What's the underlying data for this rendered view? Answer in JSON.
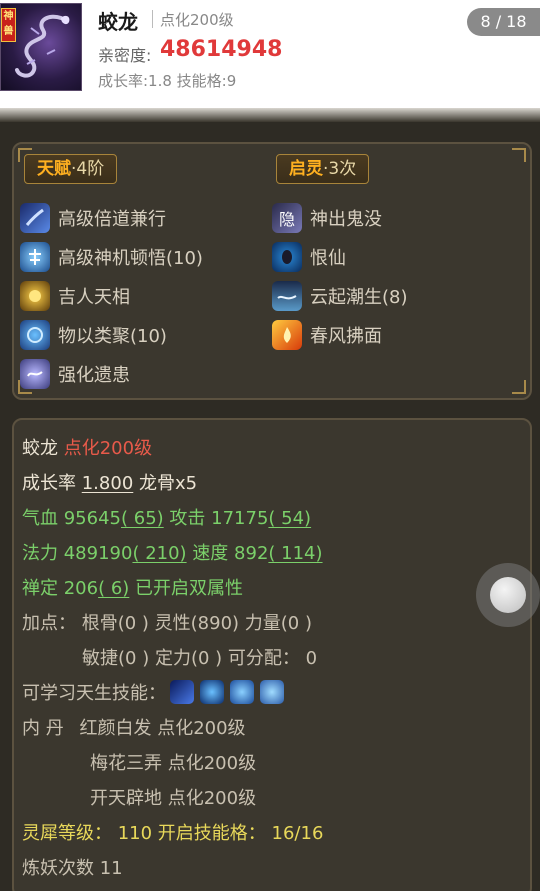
{
  "header": {
    "god_tag": "神兽",
    "pet_name": "蛟龙",
    "pet_level": "点化200级",
    "intimacy_label": "亲密度:",
    "intimacy_value": "48614948",
    "growth_line": "成长率:1.8  技能格:9",
    "page_indicator": "8 / 18"
  },
  "skills": {
    "talent_tag": {
      "name": "天赋",
      "suffix": "·4阶"
    },
    "awaken_tag": {
      "name": "启灵",
      "suffix": "·3次"
    },
    "left": [
      {
        "label": "高级倍道兼行",
        "icon": "wind-blade-icon",
        "color": "#3a6ad8"
      },
      {
        "label": "高级神机顿悟(10)",
        "icon": "divine-insight-icon",
        "color": "#3aa0e8"
      },
      {
        "label": "吉人天相",
        "icon": "golden-fortune-icon",
        "color": "#b8860b"
      },
      {
        "label": "物以类聚(10)",
        "icon": "gather-icon",
        "color": "#2a6ab8"
      },
      {
        "label": "强化遗患",
        "icon": "lingering-bane-icon",
        "color": "#6a6ab8"
      }
    ],
    "right": [
      {
        "label": "神出鬼没",
        "icon": "stealth-icon",
        "color": "#5a5a9a",
        "glyph": "隐"
      },
      {
        "label": "恨仙",
        "icon": "ghost-face-icon",
        "color": "#3a7ab8"
      },
      {
        "label": "云起潮生(8)",
        "icon": "tide-icon",
        "color": "#2a5a8a"
      },
      {
        "label": "春风拂面",
        "icon": "flame-icon",
        "color": "#d85a1a"
      }
    ]
  },
  "stats": {
    "name": "蛟龙",
    "level": "点化200级",
    "growth_label": "成长率",
    "growth_value": "1.800",
    "dragon_bone": "龙骨x5",
    "hp_label": "气血",
    "hp_value": "95645",
    "hp_bonus": "( 65)",
    "atk_label": "攻击",
    "atk_value": "17175",
    "atk_bonus": "( 54)",
    "mp_label": "法力",
    "mp_value": "489190",
    "mp_bonus": "( 210)",
    "spd_label": "速度",
    "spd_value": "892",
    "spd_bonus": "( 114)",
    "focus_label": "禅定",
    "focus_value": "206",
    "focus_bonus": "( 6)",
    "dual_attr": "已开启双属性",
    "points_line1": "加点：  根骨(0 ) 灵性(890) 力量(0 )",
    "points_line2": "敏捷(0 ) 定力(0 ) 可分配：  0",
    "learnable_label": "可学习天生技能：",
    "learnable_icons": [
      {
        "icon": "blade-skill-icon",
        "color": "#1a3a9a"
      },
      {
        "icon": "swirl-skill-icon",
        "color": "#2a6ac8"
      },
      {
        "icon": "dragon-skill-icon",
        "color": "#3a7ad8"
      },
      {
        "icon": "orb-skill-icon",
        "color": "#4a8ae8"
      }
    ],
    "neidan_label": "内    丹",
    "neidan": [
      "红颜白发 点化200级",
      "梅花三弄 点化200级",
      "开天辟地 点化200级"
    ],
    "lingxi_line": "灵犀等级：  110  开启技能格：  16/16",
    "refine_line": "炼妖次数  11"
  }
}
